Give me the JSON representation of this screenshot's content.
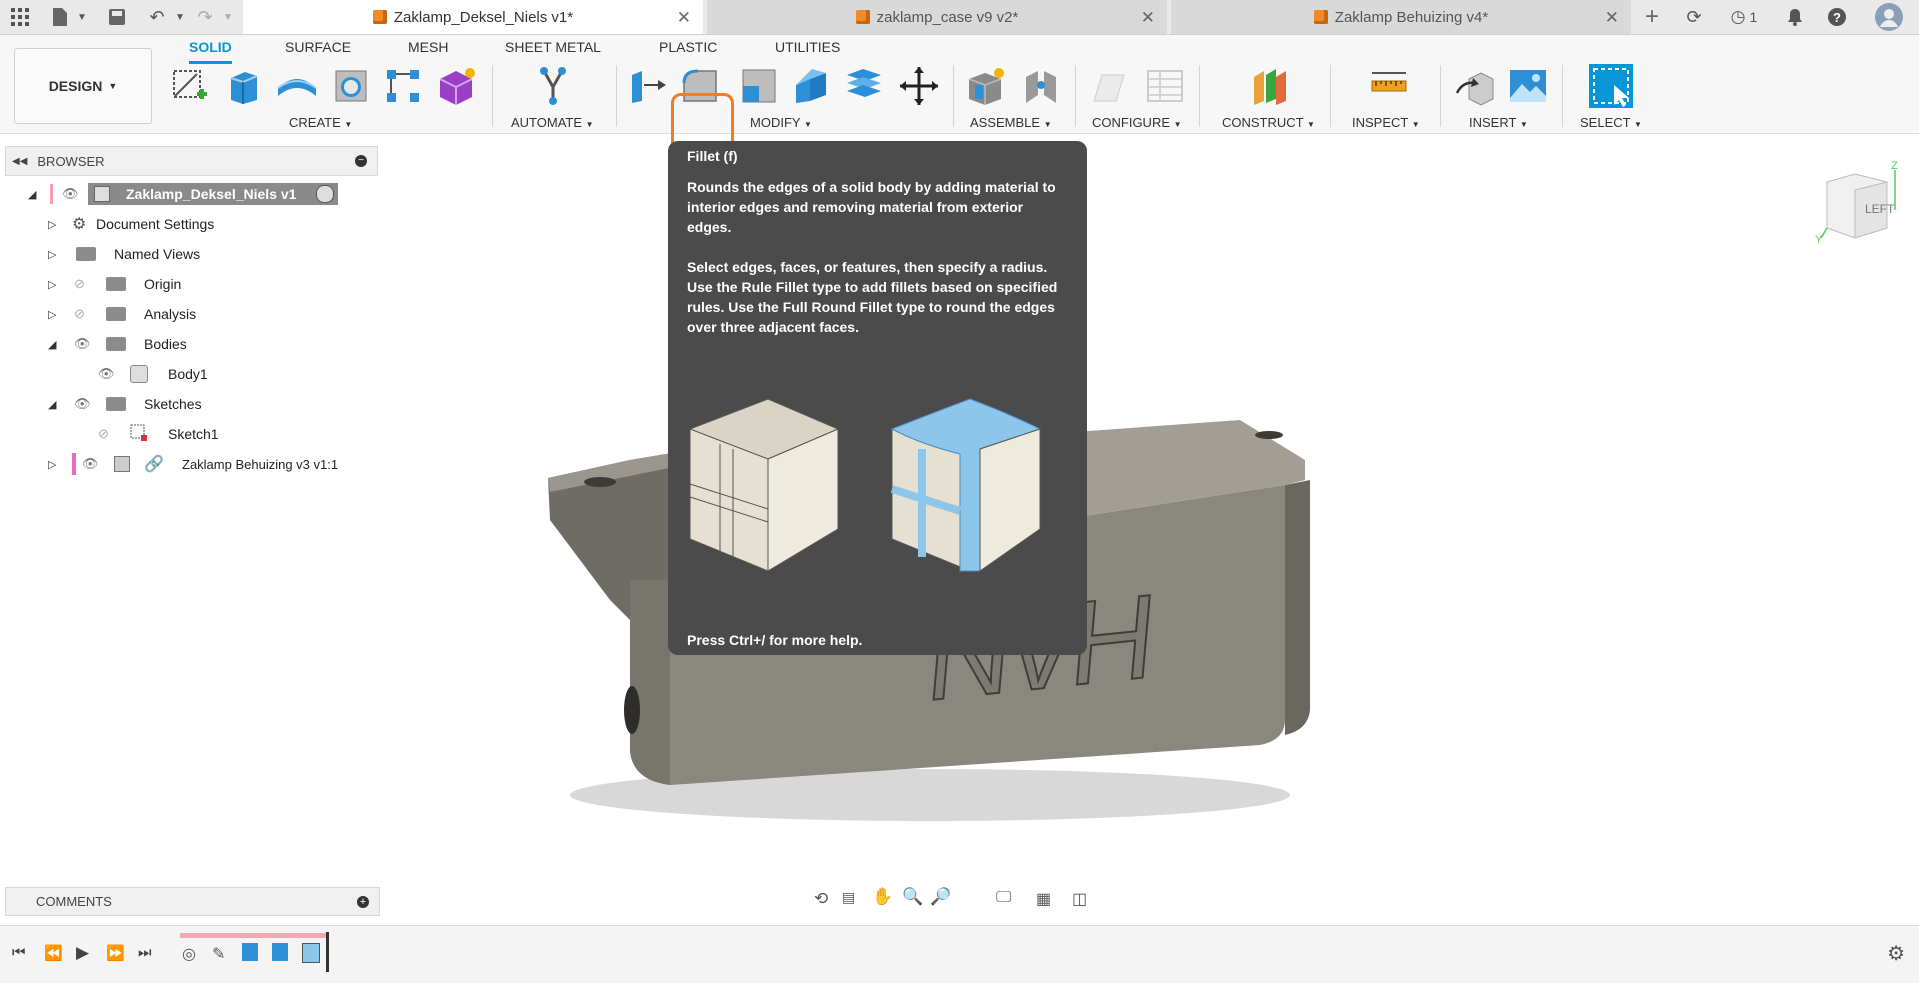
{
  "titlebar": {
    "icons": [
      "apps-grid-icon",
      "file-icon",
      "save-icon",
      "undo-icon",
      "redo-icon"
    ],
    "tabs": [
      {
        "label": "Zaklamp_Deksel_Niels v1*",
        "active": true
      },
      {
        "label": "zaklamp_case v9 v2*",
        "active": false
      },
      {
        "label": "Zaklamp Behuizing v4*",
        "active": false
      }
    ],
    "right": {
      "job_count": "1"
    }
  },
  "ribbon": {
    "workspace": "DESIGN",
    "tabs": [
      "SOLID",
      "SURFACE",
      "MESH",
      "SHEET METAL",
      "PLASTIC",
      "UTILITIES"
    ],
    "active_tab": "SOLID",
    "groups": [
      "CREATE",
      "AUTOMATE",
      "MODIFY",
      "ASSEMBLE",
      "CONFIGURE",
      "CONSTRUCT",
      "INSPECT",
      "INSERT",
      "SELECT"
    ]
  },
  "browser": {
    "title": "BROWSER",
    "items": [
      {
        "label": "Zaklamp_Deksel_Niels v1",
        "level": 0
      },
      {
        "label": "Document Settings",
        "level": 1
      },
      {
        "label": "Named Views",
        "level": 1
      },
      {
        "label": "Origin",
        "level": 1
      },
      {
        "label": "Analysis",
        "level": 1
      },
      {
        "label": "Bodies",
        "level": 1
      },
      {
        "label": "Body1",
        "level": 2
      },
      {
        "label": "Sketches",
        "level": 1
      },
      {
        "label": "Sketch1",
        "level": 2
      },
      {
        "label": "Zaklamp Behuizing v3 v1:1",
        "level": 1
      }
    ]
  },
  "tooltip": {
    "title": "Fillet (f)",
    "para1": "Rounds the edges of a solid body by adding material to interior edges and removing material from exterior edges.",
    "para2": "Select edges, faces, or features, then specify a radius. Use the Rule Fillet type to add fillets based on specified rules. Use the Full Round Fillet type to round the edges over three adjacent faces.",
    "footer": "Press Ctrl+/ for more help."
  },
  "viewcube": {
    "face": "LEFT",
    "axis_z": "Z",
    "axis_y": "Y"
  },
  "model": {
    "emboss_text": "NvH"
  },
  "comments": {
    "title": "COMMENTS"
  },
  "colors": {
    "accent": "#0696d7",
    "highlight": "#f07c24",
    "tooltip_bg": "#4b4b4b",
    "model": "#8a877e"
  }
}
